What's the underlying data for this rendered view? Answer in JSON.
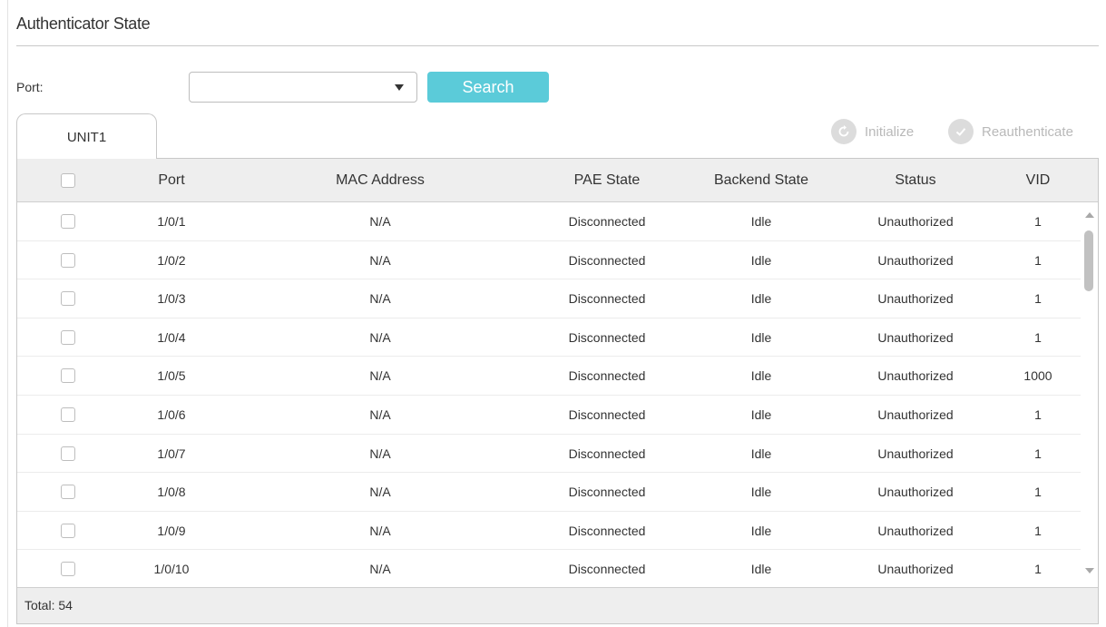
{
  "header": {
    "title": "Authenticator State"
  },
  "filter": {
    "port_label": "Port:",
    "port_value": "",
    "search_label": "Search"
  },
  "tabs": [
    {
      "label": "UNIT1"
    }
  ],
  "actions": {
    "initialize_label": "Initialize",
    "reauthenticate_label": "Reauthenticate"
  },
  "table": {
    "columns": [
      "Port",
      "MAC Address",
      "PAE State",
      "Backend State",
      "Status",
      "VID"
    ],
    "rows": [
      [
        "1/0/1",
        "N/A",
        "Disconnected",
        "Idle",
        "Unauthorized",
        "1"
      ],
      [
        "1/0/2",
        "N/A",
        "Disconnected",
        "Idle",
        "Unauthorized",
        "1"
      ],
      [
        "1/0/3",
        "N/A",
        "Disconnected",
        "Idle",
        "Unauthorized",
        "1"
      ],
      [
        "1/0/4",
        "N/A",
        "Disconnected",
        "Idle",
        "Unauthorized",
        "1"
      ],
      [
        "1/0/5",
        "N/A",
        "Disconnected",
        "Idle",
        "Unauthorized",
        "1000"
      ],
      [
        "1/0/6",
        "N/A",
        "Disconnected",
        "Idle",
        "Unauthorized",
        "1"
      ],
      [
        "1/0/7",
        "N/A",
        "Disconnected",
        "Idle",
        "Unauthorized",
        "1"
      ],
      [
        "1/0/8",
        "N/A",
        "Disconnected",
        "Idle",
        "Unauthorized",
        "1"
      ],
      [
        "1/0/9",
        "N/A",
        "Disconnected",
        "Idle",
        "Unauthorized",
        "1"
      ],
      [
        "1/0/10",
        "N/A",
        "Disconnected",
        "Idle",
        "Unauthorized",
        "1"
      ]
    ],
    "total_label": "Total: 54"
  },
  "colors": {
    "accent": "#5bcbd9",
    "header_bg": "#eeeeee",
    "disabled": "#b9b9b9"
  },
  "icons": {
    "initialize": "refresh-icon",
    "reauthenticate": "check-circle-icon",
    "dropdown": "chevron-down-icon"
  }
}
